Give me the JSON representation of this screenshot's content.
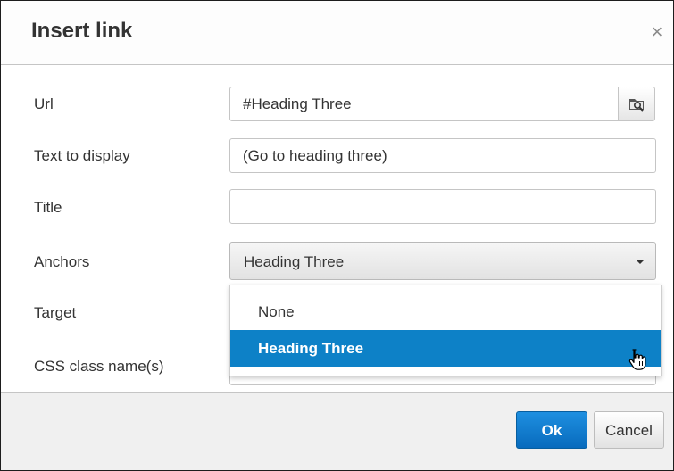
{
  "dialog": {
    "title": "Insert link",
    "close_symbol": "×"
  },
  "fields": {
    "url": {
      "label": "Url",
      "value": "#Heading Three"
    },
    "text_to_display": {
      "label": "Text to display",
      "value": "(Go to heading three)"
    },
    "title": {
      "label": "Title",
      "value": ""
    },
    "anchors": {
      "label": "Anchors",
      "selected": "Heading Three"
    },
    "target": {
      "label": "Target"
    },
    "css_class": {
      "label": "CSS class name(s)"
    }
  },
  "anchors_menu": {
    "options": [
      "None",
      "Heading Three"
    ],
    "highlighted": "Heading Three"
  },
  "footer": {
    "ok_label": "Ok",
    "cancel_label": "Cancel"
  },
  "icons": {
    "browse": "folder-search-icon",
    "caret": "chevron-down-icon",
    "close": "close-icon",
    "pointer": "hand-pointer-cursor-icon"
  },
  "colors": {
    "primary": "#0d81c7",
    "highlight": "#0d81c7"
  }
}
